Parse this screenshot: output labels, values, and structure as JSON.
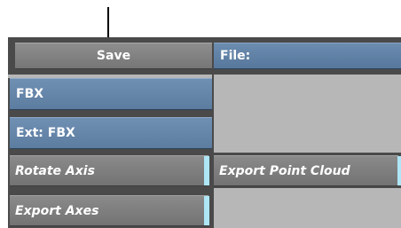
{
  "save_button": {
    "label": "Save"
  },
  "file_field": {
    "label": "File:"
  },
  "format_selector": {
    "value": "FBX"
  },
  "extension_field": {
    "label": "Ext: FBX"
  },
  "toggles": {
    "rotate_axis": {
      "label": "Rotate Axis",
      "state": "on"
    },
    "export_point_cloud": {
      "label": "Export Point Cloud",
      "state": "on"
    },
    "export_axes": {
      "label": "Export Axes",
      "state": "on"
    }
  },
  "colors": {
    "button_grey": "#7f7f7f",
    "button_blue": "#6685a9",
    "panel_background": "#b7b7b7",
    "indicator_on": "#aee6f5"
  }
}
